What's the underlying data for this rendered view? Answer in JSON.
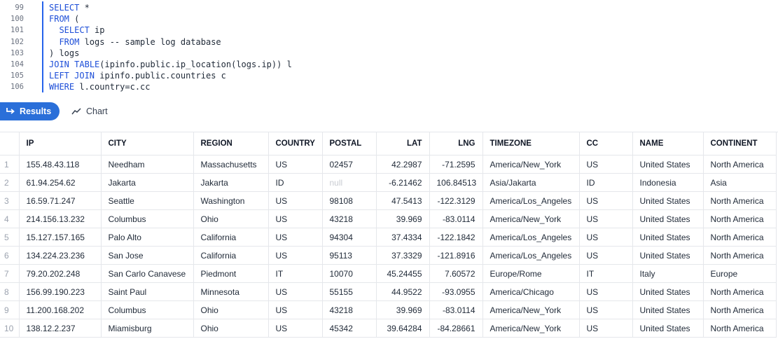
{
  "editor": {
    "lines": [
      {
        "n": "99",
        "text": "SELECT *"
      },
      {
        "n": "100",
        "text": "FROM ("
      },
      {
        "n": "101",
        "text": "  SELECT ip"
      },
      {
        "n": "102",
        "text": "  FROM logs -- sample log database"
      },
      {
        "n": "103",
        "text": ") logs"
      },
      {
        "n": "104",
        "text": "JOIN TABLE(ipinfo.public.ip_location(logs.ip)) l"
      },
      {
        "n": "105",
        "text": "LEFT JOIN ipinfo.public.countries c"
      },
      {
        "n": "106",
        "text": "WHERE l.country=c.cc"
      }
    ]
  },
  "toolbar": {
    "results_label": "Results",
    "chart_label": "Chart"
  },
  "table": {
    "columns": [
      "IP",
      "CITY",
      "REGION",
      "COUNTRY",
      "POSTAL",
      "LAT",
      "LNG",
      "TIMEZONE",
      "CC",
      "NAME",
      "CONTINENT"
    ],
    "rows": [
      [
        "155.48.43.118",
        "Needham",
        "Massachusetts",
        "US",
        "02457",
        "42.2987",
        "-71.2595",
        "America/New_York",
        "US",
        "United States",
        "North America"
      ],
      [
        "61.94.254.62",
        "Jakarta",
        "Jakarta",
        "ID",
        "null",
        "-6.21462",
        "106.84513",
        "Asia/Jakarta",
        "ID",
        "Indonesia",
        "Asia"
      ],
      [
        "16.59.71.247",
        "Seattle",
        "Washington",
        "US",
        "98108",
        "47.5413",
        "-122.3129",
        "America/Los_Angeles",
        "US",
        "United States",
        "North America"
      ],
      [
        "214.156.13.232",
        "Columbus",
        "Ohio",
        "US",
        "43218",
        "39.969",
        "-83.0114",
        "America/New_York",
        "US",
        "United States",
        "North America"
      ],
      [
        "15.127.157.165",
        "Palo Alto",
        "California",
        "US",
        "94304",
        "37.4334",
        "-122.1842",
        "America/Los_Angeles",
        "US",
        "United States",
        "North America"
      ],
      [
        "134.224.23.236",
        "San Jose",
        "California",
        "US",
        "95113",
        "37.3329",
        "-121.8916",
        "America/Los_Angeles",
        "US",
        "United States",
        "North America"
      ],
      [
        "79.20.202.248",
        "San Carlo Canavese",
        "Piedmont",
        "IT",
        "10070",
        "45.24455",
        "7.60572",
        "Europe/Rome",
        "IT",
        "Italy",
        "Europe"
      ],
      [
        "156.99.190.223",
        "Saint Paul",
        "Minnesota",
        "US",
        "55155",
        "44.9522",
        "-93.0955",
        "America/Chicago",
        "US",
        "United States",
        "North America"
      ],
      [
        "11.200.168.202",
        "Columbus",
        "Ohio",
        "US",
        "43218",
        "39.969",
        "-83.0114",
        "America/New_York",
        "US",
        "United States",
        "North America"
      ],
      [
        "138.12.2.237",
        "Miamisburg",
        "Ohio",
        "US",
        "45342",
        "39.64284",
        "-84.28661",
        "America/New_York",
        "US",
        "United States",
        "North America"
      ]
    ]
  }
}
